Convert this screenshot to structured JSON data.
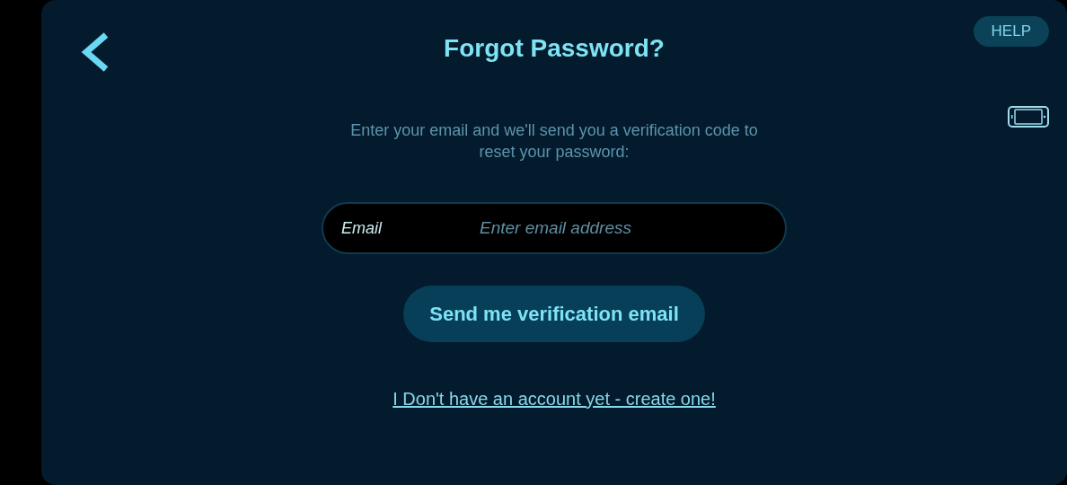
{
  "header": {
    "title": "Forgot Password?",
    "help_button": "HELP"
  },
  "instructions": "Enter your email and we'll send you a verification code to reset your password:",
  "email_field": {
    "label": "Email",
    "placeholder": "Enter email address"
  },
  "submit_button": "Send me verification email",
  "signup_link": "I Don't have an account yet - create one!"
}
